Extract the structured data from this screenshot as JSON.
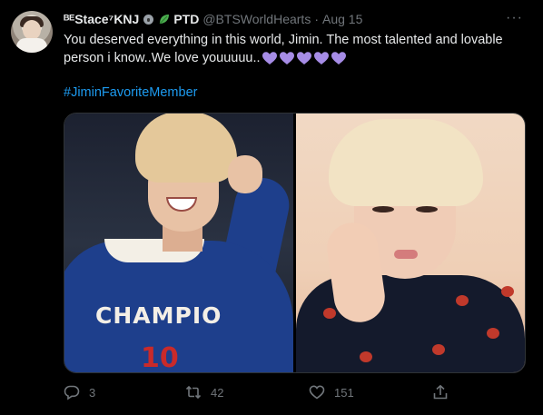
{
  "tweet": {
    "display_name": "ᴮᴱStace⁷KNJ",
    "display_name_suffix": "PTD",
    "handle": "@BTSWorldHearts",
    "separator": "·",
    "date": "Aug 15",
    "text": "You deserved everything in this world, Jimin. The most talented and lovable person i know..We love youuuuu..",
    "hearts": [
      "purple-heart",
      "purple-heart",
      "purple-heart",
      "purple-heart",
      "purple-heart"
    ],
    "hashtag": "#JiminFavoriteMember",
    "more_label": "···"
  },
  "media": {
    "left_photo_text": "CHAMPIO",
    "left_photo_number": "10"
  },
  "actions": {
    "reply_count": "3",
    "retweet_count": "42",
    "like_count": "151"
  },
  "colors": {
    "background": "#000000",
    "text": "#e7e9ea",
    "muted": "#71767b",
    "link": "#1d9bf0",
    "heart": "#a68ce6"
  }
}
